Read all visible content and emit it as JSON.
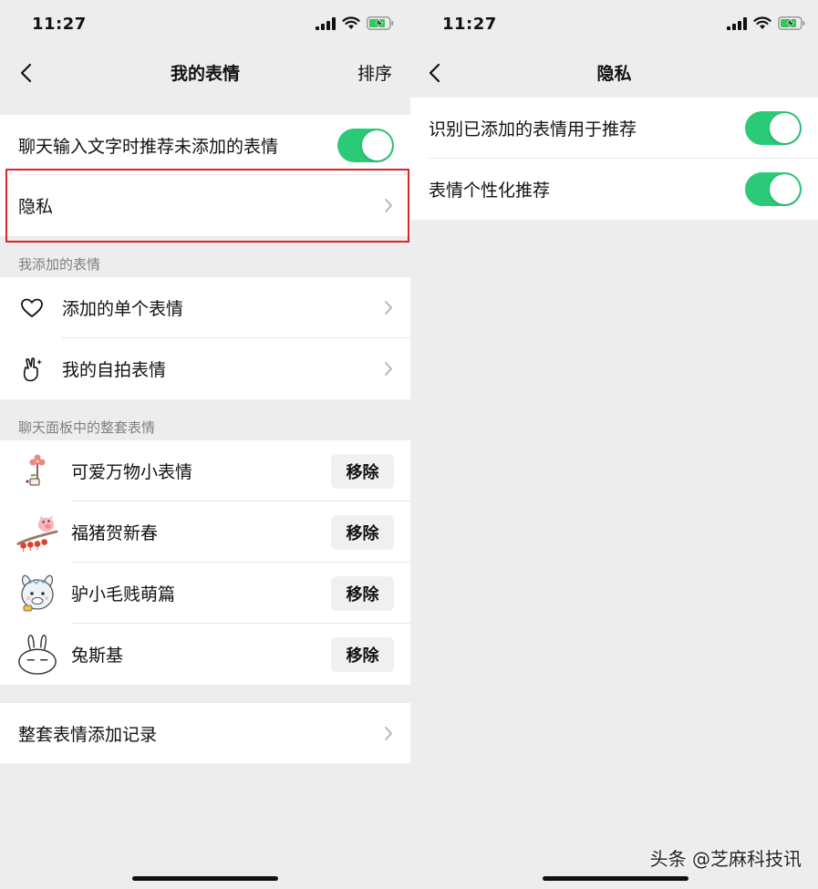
{
  "left_screen": {
    "status": {
      "time": "11:27"
    },
    "nav": {
      "title": "我的表情",
      "action": "排序"
    },
    "toggle_row": {
      "label": "聊天输入文字时推荐未添加的表情",
      "on": true
    },
    "privacy_row": {
      "label": "隐私"
    },
    "my_added": {
      "header": "我添加的表情",
      "items": [
        {
          "label": "添加的单个表情",
          "icon": "heart-icon"
        },
        {
          "label": "我的自拍表情",
          "icon": "selfie-hand-icon"
        }
      ]
    },
    "packs": {
      "header": "聊天面板中的整套表情",
      "items": [
        {
          "name": "可爱万物小表情",
          "button": "移除",
          "thumb": "flower-sticker"
        },
        {
          "name": "福猪贺新春",
          "button": "移除",
          "thumb": "pig-sticker"
        },
        {
          "name": "驴小毛贱萌篇",
          "button": "移除",
          "thumb": "donkey-sticker"
        },
        {
          "name": "兔斯基",
          "button": "移除",
          "thumb": "rabbit-sticker"
        }
      ]
    },
    "history_row": {
      "label": "整套表情添加记录"
    }
  },
  "right_screen": {
    "status": {
      "time": "11:27"
    },
    "nav": {
      "title": "隐私"
    },
    "rows": [
      {
        "label": "识别已添加的表情用于推荐",
        "on": true
      },
      {
        "label": "表情个性化推荐",
        "on": true
      }
    ]
  },
  "watermark": "头条 @芝麻科技讯",
  "colors": {
    "toggle_on": "#07c160",
    "highlight": "#d9242b",
    "background": "#ededed"
  }
}
